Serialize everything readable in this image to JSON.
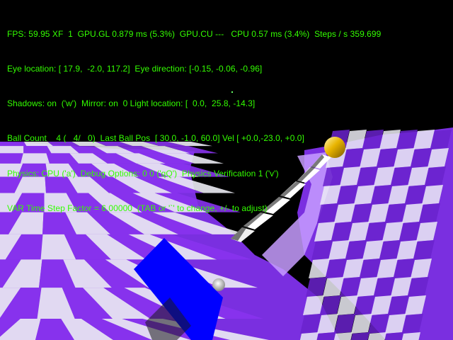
{
  "hud": {
    "lines": [
      "FPS: 59.95 XF  1  GPU.GL 0.879 ms (5.3%)  GPU.CU ---   CPU 0.57 ms (3.4%)  Steps / s 359.699",
      "Eye location: [ 17.9,  -2.0, 117.2]  Eye direction: [-0.15, -0.06, -0.96]",
      "Shadows: on  ('w')  Mirror: on  0 Light location: [  0.0,  25.8, -14.3]",
      "Ball Count    4 (   4/   0)  Last Ball Pos  [ 30.0, -1.0, 60.0] Vel [ +0.0,-23.0, +0.0]",
      "Physics: CPU ('a')  Debug Options: 0 0 ('qQ')  Physics Verification 1 ('v')",
      "VAR Time Step Factor = 6.00000  (TAB or '`' to change, +/- to adjust)"
    ],
    "color": "#33ff00"
  },
  "scene": {
    "background": "#000000",
    "tile_colors": [
      "#8833ee",
      "#ececf4",
      "#6a22cc",
      "#b585ff"
    ],
    "box_color": "#0000ff",
    "ball_color": "#e8b400",
    "stair_color": "#ffffff"
  }
}
